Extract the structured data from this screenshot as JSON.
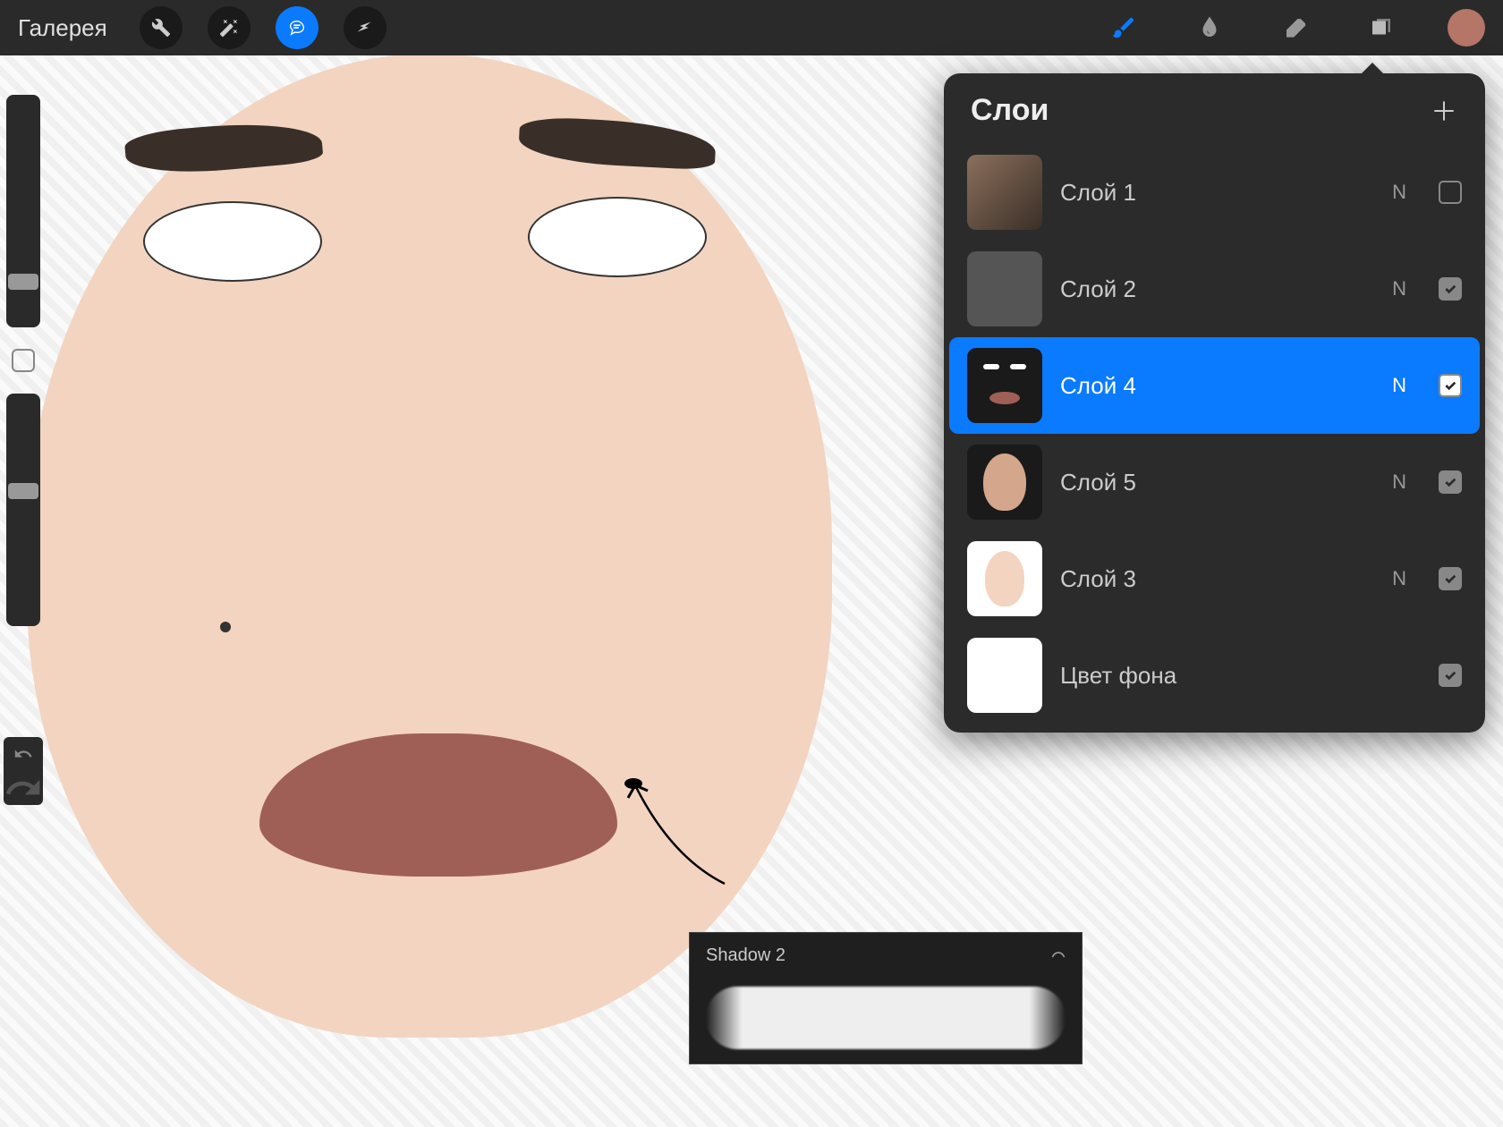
{
  "topbar": {
    "gallery": "Галерея"
  },
  "layers_panel": {
    "title": "Слои"
  },
  "layers": [
    {
      "name": "Слой 1",
      "blend": "N",
      "visible": false,
      "thumb": "photo"
    },
    {
      "name": "Слой 2",
      "blend": "N",
      "visible": true,
      "thumb": "sketch"
    },
    {
      "name": "Слой 4",
      "blend": "N",
      "visible": true,
      "thumb": "darkface",
      "selected": true
    },
    {
      "name": "Слой 5",
      "blend": "N",
      "visible": true,
      "thumb": "shading"
    },
    {
      "name": "Слой 3",
      "blend": "N",
      "visible": true,
      "thumb": "skin"
    },
    {
      "name": "Цвет фона",
      "blend": "",
      "visible": true,
      "thumb": "white",
      "bg": true
    }
  ],
  "brush": {
    "name": "Shadow 2"
  },
  "color": "#b57567"
}
